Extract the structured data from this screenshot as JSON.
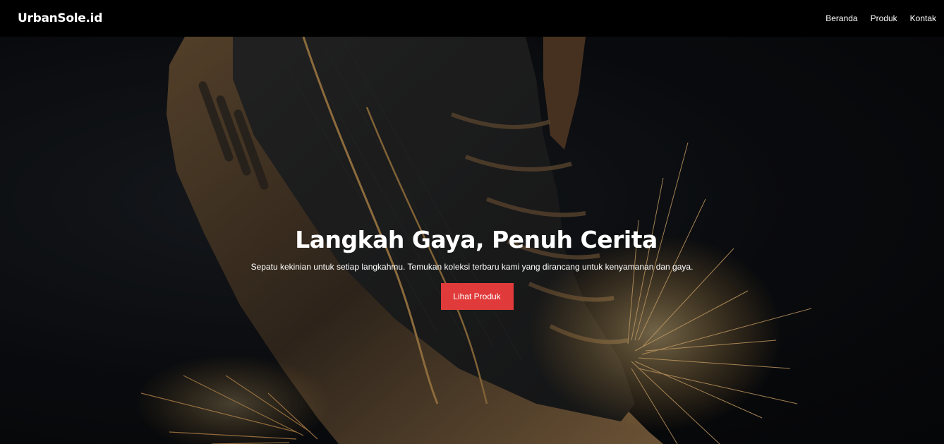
{
  "navbar": {
    "brand": "UrbanSole.id",
    "links": [
      "Beranda",
      "Produk",
      "Kontak"
    ]
  },
  "hero": {
    "title": "Langkah Gaya, Penuh Cerita",
    "subtitle": "Sepatu kekinian untuk setiap langkahmu. Temukan koleksi terbaru kami yang dirancang untuk kenyamanan dan gaya.",
    "cta_label": "Lihat Produk",
    "background_image": "sneaker-with-sparks-photo"
  },
  "colors": {
    "navbar_bg": "#000000",
    "cta_bg": "#e03a3a",
    "text": "#ffffff"
  }
}
